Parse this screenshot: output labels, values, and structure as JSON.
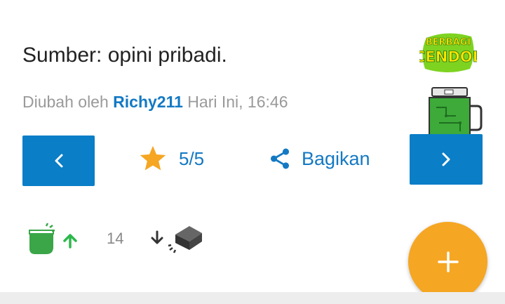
{
  "post": {
    "text": "Sumber: opini pribadi.",
    "edited_prefix": "Diubah oleh",
    "edited_user": "Richy211",
    "edited_time": "Hari Ini, 16:46"
  },
  "actions": {
    "prev_icon": "chevron-left-icon",
    "next_icon": "chevron-right-icon",
    "rating_value": "5/5",
    "rating_icon": "star-icon",
    "share_label": "Bagikan",
    "share_icon": "share-icon"
  },
  "votes": {
    "count": "14",
    "upvote_icon": "cendol-upvote-icon",
    "downvote_icon": "bata-downvote-icon"
  },
  "badges": {
    "cendol_logo_text": "BERBAGI CENDOL",
    "jar_icon": "cendol-jar-icon"
  },
  "colors": {
    "accent_blue": "#0a7ec7",
    "star": "#f5a623",
    "fab": "#f5a623",
    "upvote_green": "#2db84d"
  }
}
